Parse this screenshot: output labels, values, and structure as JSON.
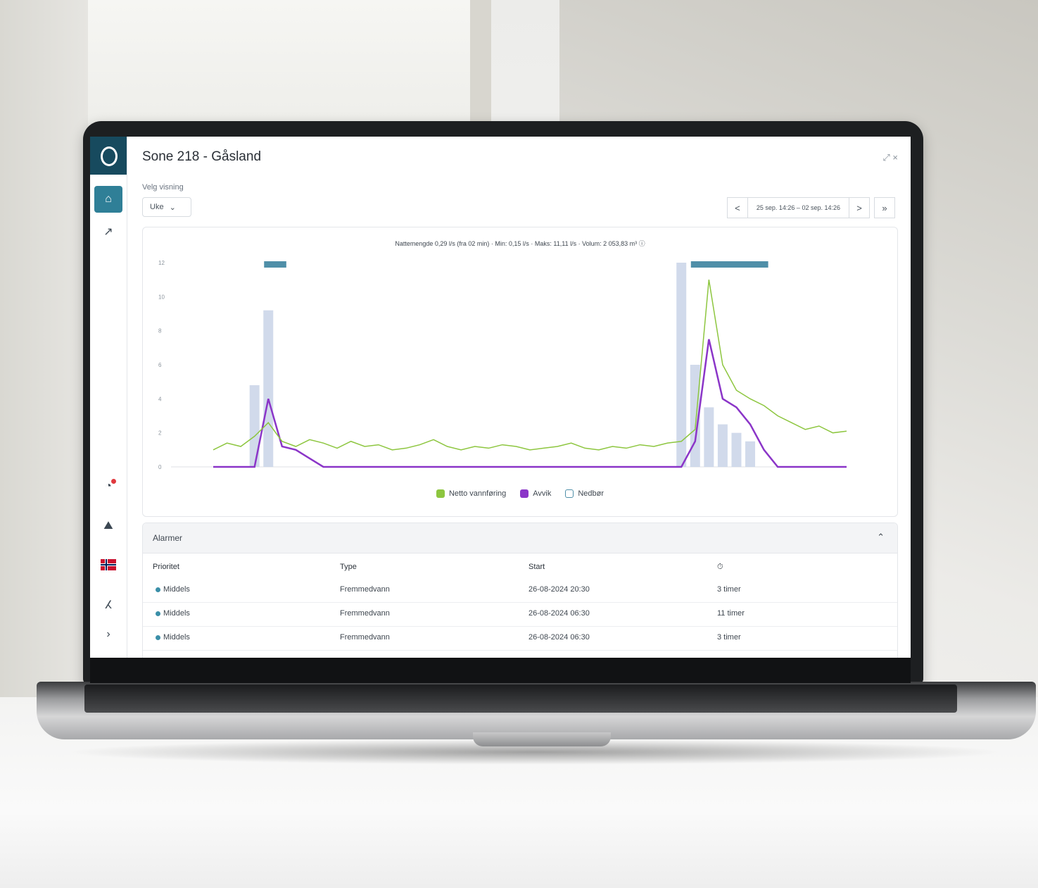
{
  "app": {
    "title": "Sone 218 - Gåsland",
    "top_icons": "⤢ ×"
  },
  "selector": {
    "label": "Velg visning",
    "value": "Uke"
  },
  "pager": {
    "first": "<",
    "range": "25 sep. 14:26 – 02 sep. 14:26",
    "next": ">",
    "last": "»"
  },
  "chart": {
    "stats": "Nattemengde 0,29 l/s (fra 02 min)  ·  Min: 0,15 l/s  ·  Maks: 11,11 l/s  ·  Volum: 2 053,83 m³  ⓘ"
  },
  "chart_data": {
    "type": "line",
    "ylim": [
      0,
      12
    ],
    "yticks": [
      "12",
      "10",
      "8",
      "6",
      "4",
      "2",
      "0"
    ],
    "series": [
      {
        "name": "Netto vannføring",
        "values": [
          1.0,
          1.4,
          1.2,
          1.8,
          2.6,
          1.5,
          1.2,
          1.6,
          1.4,
          1.1,
          1.5,
          1.2,
          1.3,
          1.0,
          1.1,
          1.3,
          1.6,
          1.2,
          1.0,
          1.2,
          1.1,
          1.3,
          1.2,
          1.0,
          1.1,
          1.2,
          1.4,
          1.1,
          1.0,
          1.2,
          1.1,
          1.3,
          1.2,
          1.4,
          1.5,
          2.2,
          11.0,
          6.0,
          4.5,
          4.0,
          3.6,
          3.0,
          2.6,
          2.2,
          2.4,
          2.0,
          2.1
        ]
      },
      {
        "name": "Avvik",
        "values": [
          0,
          0,
          0,
          0,
          4.0,
          1.2,
          1.0,
          0.5,
          0,
          0,
          0,
          0,
          0,
          0,
          0,
          0,
          0,
          0,
          0,
          0,
          0,
          0,
          0,
          0,
          0,
          0,
          0,
          0,
          0,
          0,
          0,
          0,
          0,
          0,
          0,
          1.5,
          7.5,
          4.0,
          3.5,
          2.5,
          1.0,
          0,
          0,
          0,
          0,
          0,
          0
        ]
      },
      {
        "name": "Nedbør",
        "values": [
          0,
          0,
          0,
          4.8,
          9.2,
          0,
          0,
          0,
          0,
          0,
          0,
          0,
          0,
          0,
          0,
          0,
          0,
          0,
          0,
          0,
          0,
          0,
          0,
          0,
          0,
          0,
          0,
          0,
          0,
          0,
          0,
          0,
          0,
          0,
          12.0,
          6.0,
          3.5,
          2.5,
          2.0,
          1.5,
          0,
          0,
          0,
          0,
          0,
          0,
          0
        ]
      }
    ],
    "colors": {
      "netto": "#8dc63f",
      "avvik": "#8b35c8",
      "nedbor": "#c9d3e8",
      "alarm_band": "#4f8fa8"
    }
  },
  "legend": [
    {
      "label": "Netto vannføring"
    },
    {
      "label": "Avvik"
    },
    {
      "label": "Nedbør"
    }
  ],
  "alarms": {
    "title": "Alarmer",
    "headers": {
      "priority": "Prioritet",
      "type": "Type",
      "start": "Start",
      "duration": "⏱"
    },
    "rows": [
      {
        "priority": "Middels",
        "type": "Fremmedvann",
        "start": "26-08-2024 20:30",
        "duration": "3 timer"
      },
      {
        "priority": "Middels",
        "type": "Fremmedvann",
        "start": "26-08-2024 06:30",
        "duration": "11 timer"
      },
      {
        "priority": "Middels",
        "type": "Fremmedvann",
        "start": "26-08-2024 06:30",
        "duration": "3 timer"
      }
    ]
  }
}
